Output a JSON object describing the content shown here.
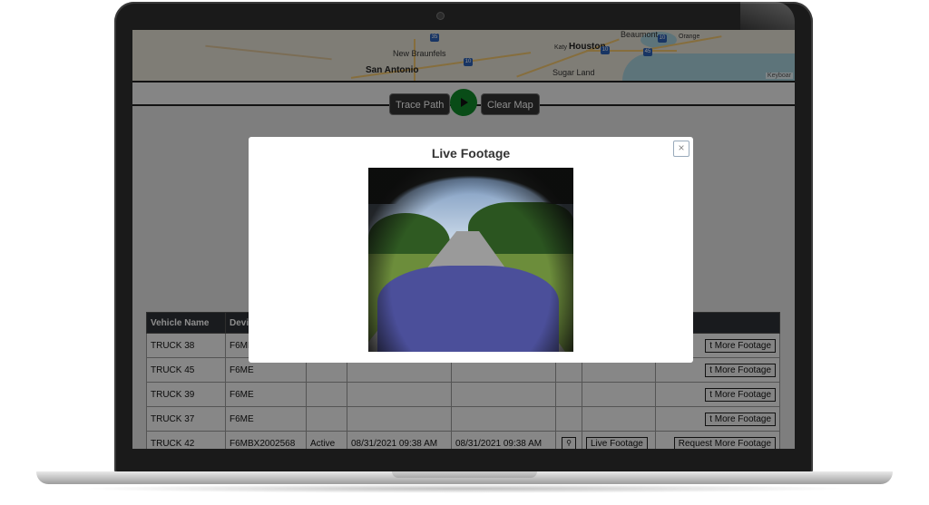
{
  "map": {
    "cities": [
      "New Braunfels",
      "San Antonio",
      "Houston",
      "Katy",
      "Sugar Land",
      "Beaumont",
      "Orange"
    ],
    "highways": [
      "35",
      "10",
      "10",
      "10",
      "45"
    ],
    "attribution": "Keyboar"
  },
  "toolbar": {
    "trace_path": "Trace Path",
    "clear_map": "Clear Map"
  },
  "table": {
    "columns": [
      "Vehicle Name",
      "Devi"
    ],
    "rows": [
      {
        "name": "TRUCK 38",
        "device": "F6ME",
        "request": "t More Footage"
      },
      {
        "name": "TRUCK 45",
        "device": "F6ME",
        "request": "t More Footage"
      },
      {
        "name": "TRUCK 39",
        "device": "F6ME",
        "request": "t More Footage"
      },
      {
        "name": "TRUCK 37",
        "device": "F6ME",
        "request": "t More Footage"
      },
      {
        "name": "TRUCK 42",
        "device": "F6MBX2002568",
        "status": "Active",
        "time1": "08/31/2021 09:38 AM",
        "time2": "08/31/2021 09:38 AM",
        "live": "Live Footage",
        "request": "Request More Footage"
      }
    ]
  },
  "modal": {
    "title": "Live Footage",
    "close": "×"
  },
  "icons": {
    "play": "play-icon",
    "pin": "map-pin-icon",
    "close": "close-icon"
  },
  "colors": {
    "play_button": "#128a2a",
    "toolbar_button": "#333333",
    "table_header": "#2e3238"
  }
}
